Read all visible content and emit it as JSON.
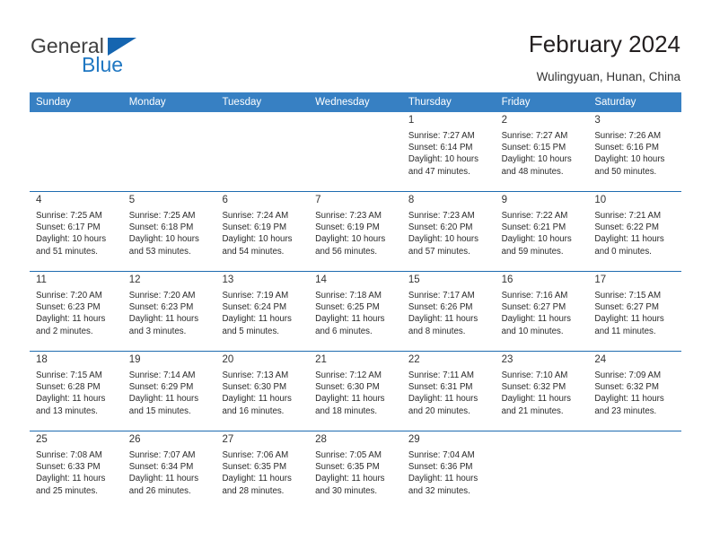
{
  "brand": {
    "name_top": "General",
    "name_bottom": "Blue",
    "accent_color": "#1565b0"
  },
  "header": {
    "title": "February 2024",
    "subtitle": "Wulingyuan, Hunan, China"
  },
  "calendar": {
    "header_bg": "#3780c3",
    "daynum_bg": "#efefef",
    "rule_color": "#1f6cb0",
    "weekdays": [
      "Sunday",
      "Monday",
      "Tuesday",
      "Wednesday",
      "Thursday",
      "Friday",
      "Saturday"
    ],
    "weeks": [
      [
        {
          "day": "",
          "lines": []
        },
        {
          "day": "",
          "lines": []
        },
        {
          "day": "",
          "lines": []
        },
        {
          "day": "",
          "lines": []
        },
        {
          "day": "1",
          "lines": [
            "Sunrise: 7:27 AM",
            "Sunset: 6:14 PM",
            "Daylight: 10 hours",
            "and 47 minutes."
          ]
        },
        {
          "day": "2",
          "lines": [
            "Sunrise: 7:27 AM",
            "Sunset: 6:15 PM",
            "Daylight: 10 hours",
            "and 48 minutes."
          ]
        },
        {
          "day": "3",
          "lines": [
            "Sunrise: 7:26 AM",
            "Sunset: 6:16 PM",
            "Daylight: 10 hours",
            "and 50 minutes."
          ]
        }
      ],
      [
        {
          "day": "4",
          "lines": [
            "Sunrise: 7:25 AM",
            "Sunset: 6:17 PM",
            "Daylight: 10 hours",
            "and 51 minutes."
          ]
        },
        {
          "day": "5",
          "lines": [
            "Sunrise: 7:25 AM",
            "Sunset: 6:18 PM",
            "Daylight: 10 hours",
            "and 53 minutes."
          ]
        },
        {
          "day": "6",
          "lines": [
            "Sunrise: 7:24 AM",
            "Sunset: 6:19 PM",
            "Daylight: 10 hours",
            "and 54 minutes."
          ]
        },
        {
          "day": "7",
          "lines": [
            "Sunrise: 7:23 AM",
            "Sunset: 6:19 PM",
            "Daylight: 10 hours",
            "and 56 minutes."
          ]
        },
        {
          "day": "8",
          "lines": [
            "Sunrise: 7:23 AM",
            "Sunset: 6:20 PM",
            "Daylight: 10 hours",
            "and 57 minutes."
          ]
        },
        {
          "day": "9",
          "lines": [
            "Sunrise: 7:22 AM",
            "Sunset: 6:21 PM",
            "Daylight: 10 hours",
            "and 59 minutes."
          ]
        },
        {
          "day": "10",
          "lines": [
            "Sunrise: 7:21 AM",
            "Sunset: 6:22 PM",
            "Daylight: 11 hours",
            "and 0 minutes."
          ]
        }
      ],
      [
        {
          "day": "11",
          "lines": [
            "Sunrise: 7:20 AM",
            "Sunset: 6:23 PM",
            "Daylight: 11 hours",
            "and 2 minutes."
          ]
        },
        {
          "day": "12",
          "lines": [
            "Sunrise: 7:20 AM",
            "Sunset: 6:23 PM",
            "Daylight: 11 hours",
            "and 3 minutes."
          ]
        },
        {
          "day": "13",
          "lines": [
            "Sunrise: 7:19 AM",
            "Sunset: 6:24 PM",
            "Daylight: 11 hours",
            "and 5 minutes."
          ]
        },
        {
          "day": "14",
          "lines": [
            "Sunrise: 7:18 AM",
            "Sunset: 6:25 PM",
            "Daylight: 11 hours",
            "and 6 minutes."
          ]
        },
        {
          "day": "15",
          "lines": [
            "Sunrise: 7:17 AM",
            "Sunset: 6:26 PM",
            "Daylight: 11 hours",
            "and 8 minutes."
          ]
        },
        {
          "day": "16",
          "lines": [
            "Sunrise: 7:16 AM",
            "Sunset: 6:27 PM",
            "Daylight: 11 hours",
            "and 10 minutes."
          ]
        },
        {
          "day": "17",
          "lines": [
            "Sunrise: 7:15 AM",
            "Sunset: 6:27 PM",
            "Daylight: 11 hours",
            "and 11 minutes."
          ]
        }
      ],
      [
        {
          "day": "18",
          "lines": [
            "Sunrise: 7:15 AM",
            "Sunset: 6:28 PM",
            "Daylight: 11 hours",
            "and 13 minutes."
          ]
        },
        {
          "day": "19",
          "lines": [
            "Sunrise: 7:14 AM",
            "Sunset: 6:29 PM",
            "Daylight: 11 hours",
            "and 15 minutes."
          ]
        },
        {
          "day": "20",
          "lines": [
            "Sunrise: 7:13 AM",
            "Sunset: 6:30 PM",
            "Daylight: 11 hours",
            "and 16 minutes."
          ]
        },
        {
          "day": "21",
          "lines": [
            "Sunrise: 7:12 AM",
            "Sunset: 6:30 PM",
            "Daylight: 11 hours",
            "and 18 minutes."
          ]
        },
        {
          "day": "22",
          "lines": [
            "Sunrise: 7:11 AM",
            "Sunset: 6:31 PM",
            "Daylight: 11 hours",
            "and 20 minutes."
          ]
        },
        {
          "day": "23",
          "lines": [
            "Sunrise: 7:10 AM",
            "Sunset: 6:32 PM",
            "Daylight: 11 hours",
            "and 21 minutes."
          ]
        },
        {
          "day": "24",
          "lines": [
            "Sunrise: 7:09 AM",
            "Sunset: 6:32 PM",
            "Daylight: 11 hours",
            "and 23 minutes."
          ]
        }
      ],
      [
        {
          "day": "25",
          "lines": [
            "Sunrise: 7:08 AM",
            "Sunset: 6:33 PM",
            "Daylight: 11 hours",
            "and 25 minutes."
          ]
        },
        {
          "day": "26",
          "lines": [
            "Sunrise: 7:07 AM",
            "Sunset: 6:34 PM",
            "Daylight: 11 hours",
            "and 26 minutes."
          ]
        },
        {
          "day": "27",
          "lines": [
            "Sunrise: 7:06 AM",
            "Sunset: 6:35 PM",
            "Daylight: 11 hours",
            "and 28 minutes."
          ]
        },
        {
          "day": "28",
          "lines": [
            "Sunrise: 7:05 AM",
            "Sunset: 6:35 PM",
            "Daylight: 11 hours",
            "and 30 minutes."
          ]
        },
        {
          "day": "29",
          "lines": [
            "Sunrise: 7:04 AM",
            "Sunset: 6:36 PM",
            "Daylight: 11 hours",
            "and 32 minutes."
          ]
        },
        {
          "day": "",
          "lines": []
        },
        {
          "day": "",
          "lines": []
        }
      ]
    ]
  }
}
